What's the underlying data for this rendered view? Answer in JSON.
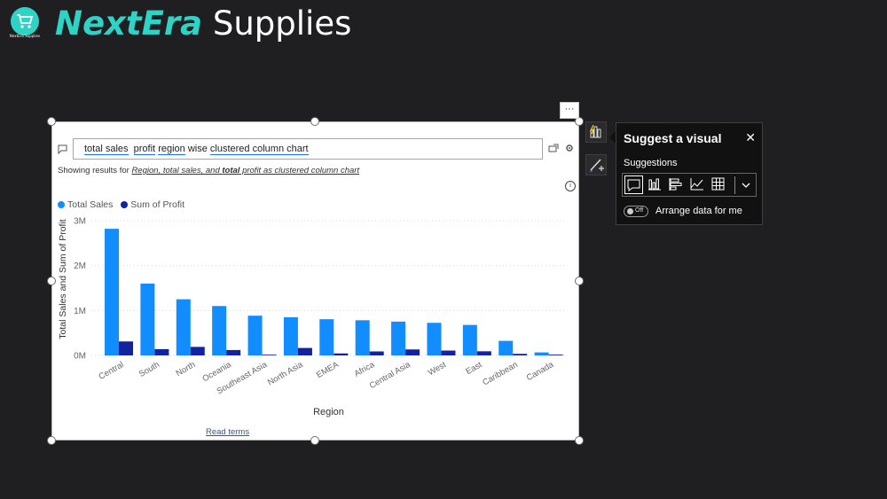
{
  "brand": {
    "logo_text": "NextEra Supplies",
    "title_part1": "NextEra",
    "title_part2": " Supplies"
  },
  "visual": {
    "more_label": "···",
    "qa": {
      "tokens": [
        "total sales",
        "profit",
        "region"
      ],
      "text_plain": "wise",
      "token_last": "clustered column chart"
    },
    "showing_prefix": "Showing results for",
    "showing_result_a": "Region, total sales, and ",
    "showing_result_b": "total",
    "showing_result_c": " profit as clustered column chart",
    "read_terms": "Read terms"
  },
  "suggest": {
    "title": "Suggest a visual",
    "close": "✕",
    "suggestions_label": "Suggestions",
    "toggle_state": "Off",
    "arrange_label": "Arrange data for me",
    "options": [
      "qa-visual",
      "clustered-column",
      "stacked-bar",
      "line-chart",
      "table"
    ]
  },
  "colors": {
    "total_sales": "#118dff",
    "profit": "#12239e",
    "brand_teal": "#2ed3c6"
  },
  "chart_data": {
    "type": "bar",
    "categories": [
      "Central",
      "South",
      "North",
      "Oceania",
      "Southeast Asia",
      "North Asia",
      "EMEA",
      "Africa",
      "Central Asia",
      "West",
      "East",
      "Caribbean",
      "Canada"
    ],
    "series": [
      {
        "name": "Total Sales",
        "values": [
          2820000,
          1600000,
          1250000,
          1100000,
          885000,
          850000,
          806000,
          783000,
          753000,
          726000,
          679000,
          324000,
          67000
        ]
      },
      {
        "name": "Sum of Profit",
        "values": [
          311000,
          140000,
          190000,
          120000,
          17000,
          166000,
          44000,
          89000,
          133000,
          108000,
          92000,
          35000,
          18000
        ]
      }
    ],
    "xlabel": "Region",
    "ylabel": "Total Sales and Sum of Profit",
    "yticks": [
      "0M",
      "1M",
      "2M",
      "3M"
    ],
    "ylim": [
      0,
      3000000
    ],
    "legend": [
      "Total Sales",
      "Sum of Profit"
    ],
    "legend_position": "top-left",
    "grid": true
  }
}
